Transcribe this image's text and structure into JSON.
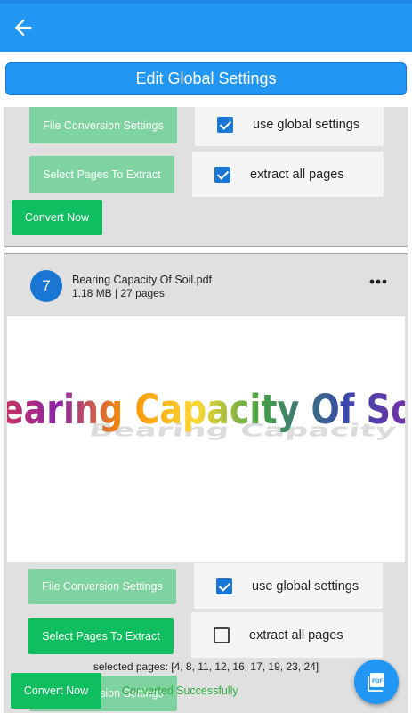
{
  "header": {
    "back_icon": "arrow-left-icon",
    "edit_global_label": "Edit Global Settings"
  },
  "cards": [
    {
      "file_conversion_label": "File Conversion Settings",
      "select_pages_label": "Select Pages To Extract",
      "use_global_label": "use global settings",
      "use_global_checked": true,
      "extract_all_label": "extract all pages",
      "extract_all_checked": true,
      "convert_label": "Convert Now"
    },
    {
      "index": "7",
      "file_name": "Bearing Capacity Of Soil.pdf",
      "file_meta": "1.18 MB  |  27 pages",
      "preview_text": "Bearing Capacity Of Soil",
      "file_conversion_label": "File Conversion Settings",
      "select_pages_label": "Select Pages To Extract",
      "use_global_label": "use global settings",
      "use_global_checked": true,
      "extract_all_label": "extract all pages",
      "extract_all_checked": false,
      "selected_pages": "selected pages: [4, 8, 11, 12, 16, 17, 19, 23, 24]",
      "convert_label": "Convert Now",
      "status": "Converted Successfully"
    }
  ],
  "fab": {
    "label": "PDF",
    "icon": "pdf-icon"
  },
  "colors": {
    "primary": "#2196f3",
    "green": "#0fbf5f",
    "green_light": "#7ed3a0",
    "success_text": "#2eab3d"
  }
}
